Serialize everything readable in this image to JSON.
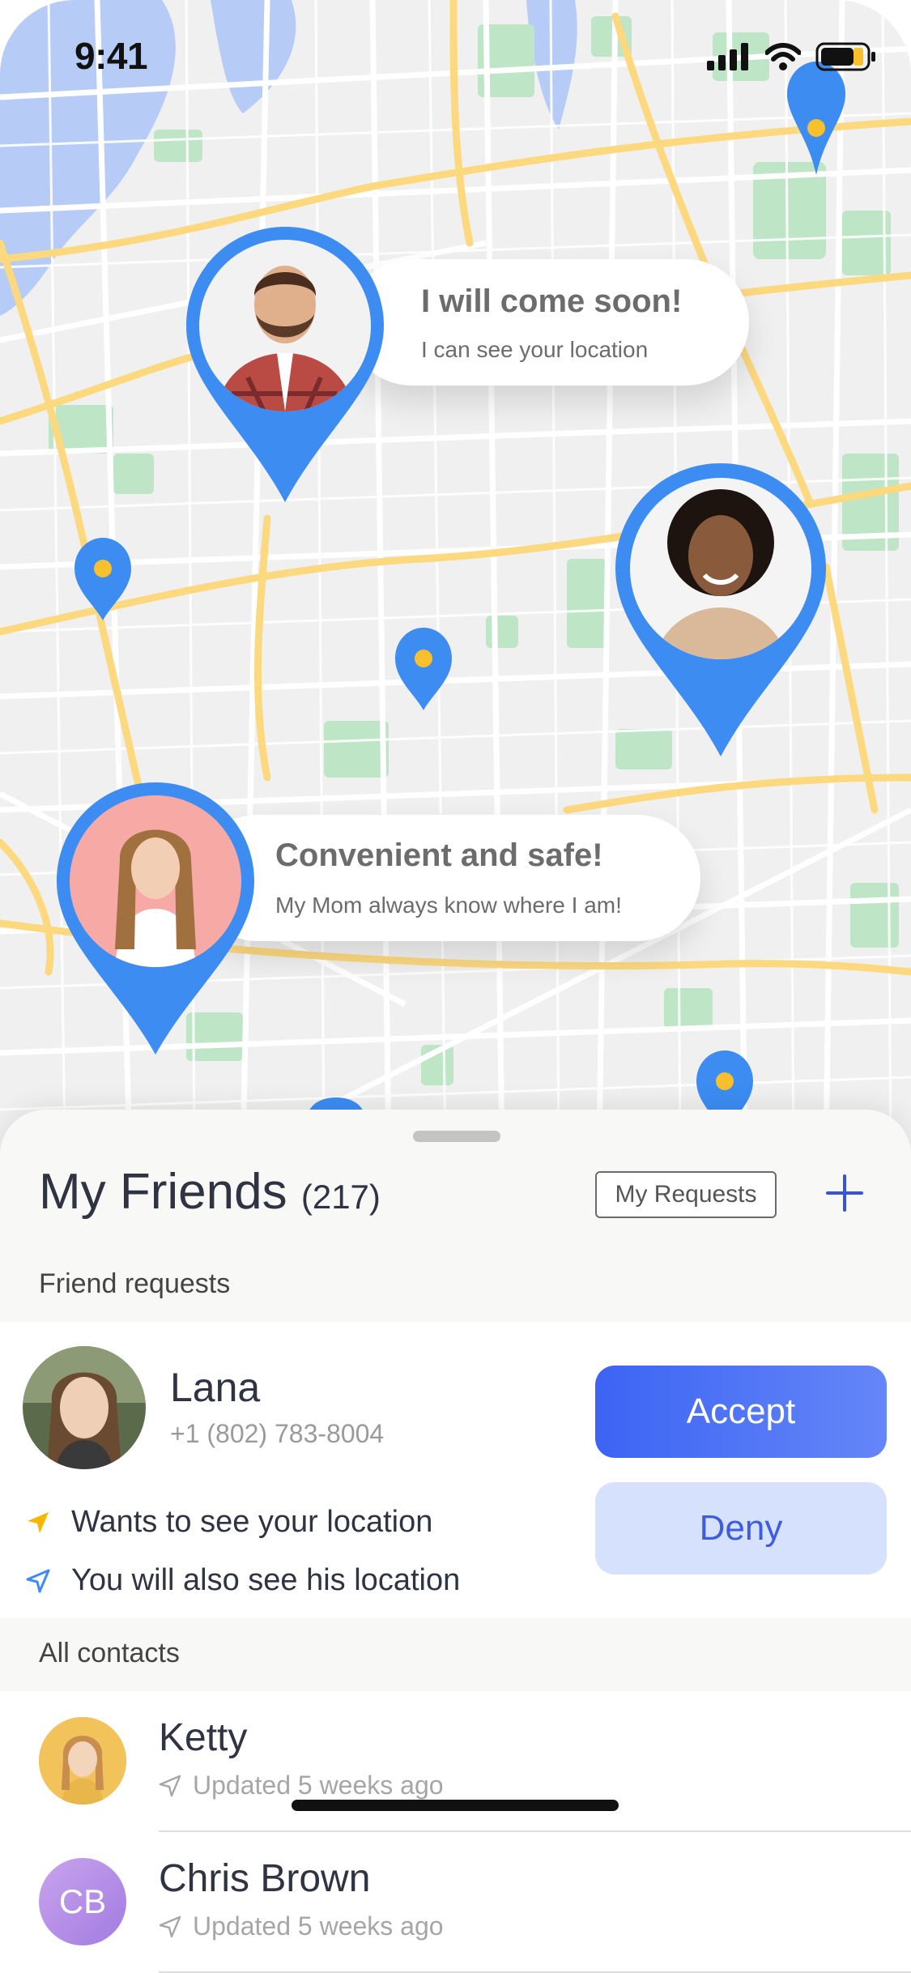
{
  "status_bar": {
    "time": "9:41"
  },
  "map": {
    "colors": {
      "base": "#f0f0f0",
      "water": "#b6ccf7",
      "park": "#bfe5c7",
      "major_road": "#fcd87f",
      "minor_road": "#ffffff",
      "pin": "#3c8cf2",
      "pin_dot": "#f7c02c"
    },
    "bubbles": [
      {
        "title": "I will come soon!",
        "subtitle": "I can see your location"
      },
      {
        "title": "Convenient and safe!",
        "subtitle": "My Mom always know where I am!"
      }
    ]
  },
  "sheet": {
    "title": "My Friends",
    "count": "(217)",
    "requests_button": "My Requests",
    "add_icon": "plus-icon",
    "friend_requests_label": "Friend requests",
    "request": {
      "name": "Lana",
      "phone": "+1 (802) 783-8004",
      "line1": "Wants to see your location",
      "line2": "You will also see his location",
      "accept": "Accept",
      "deny": "Deny"
    },
    "all_contacts_label": "All contacts",
    "contacts": [
      {
        "name": "Ketty",
        "updated": "Updated 5 weeks ago",
        "initials": ""
      },
      {
        "name": "Chris Brown",
        "updated": "Updated 5 weeks ago",
        "initials": "CB"
      }
    ]
  }
}
